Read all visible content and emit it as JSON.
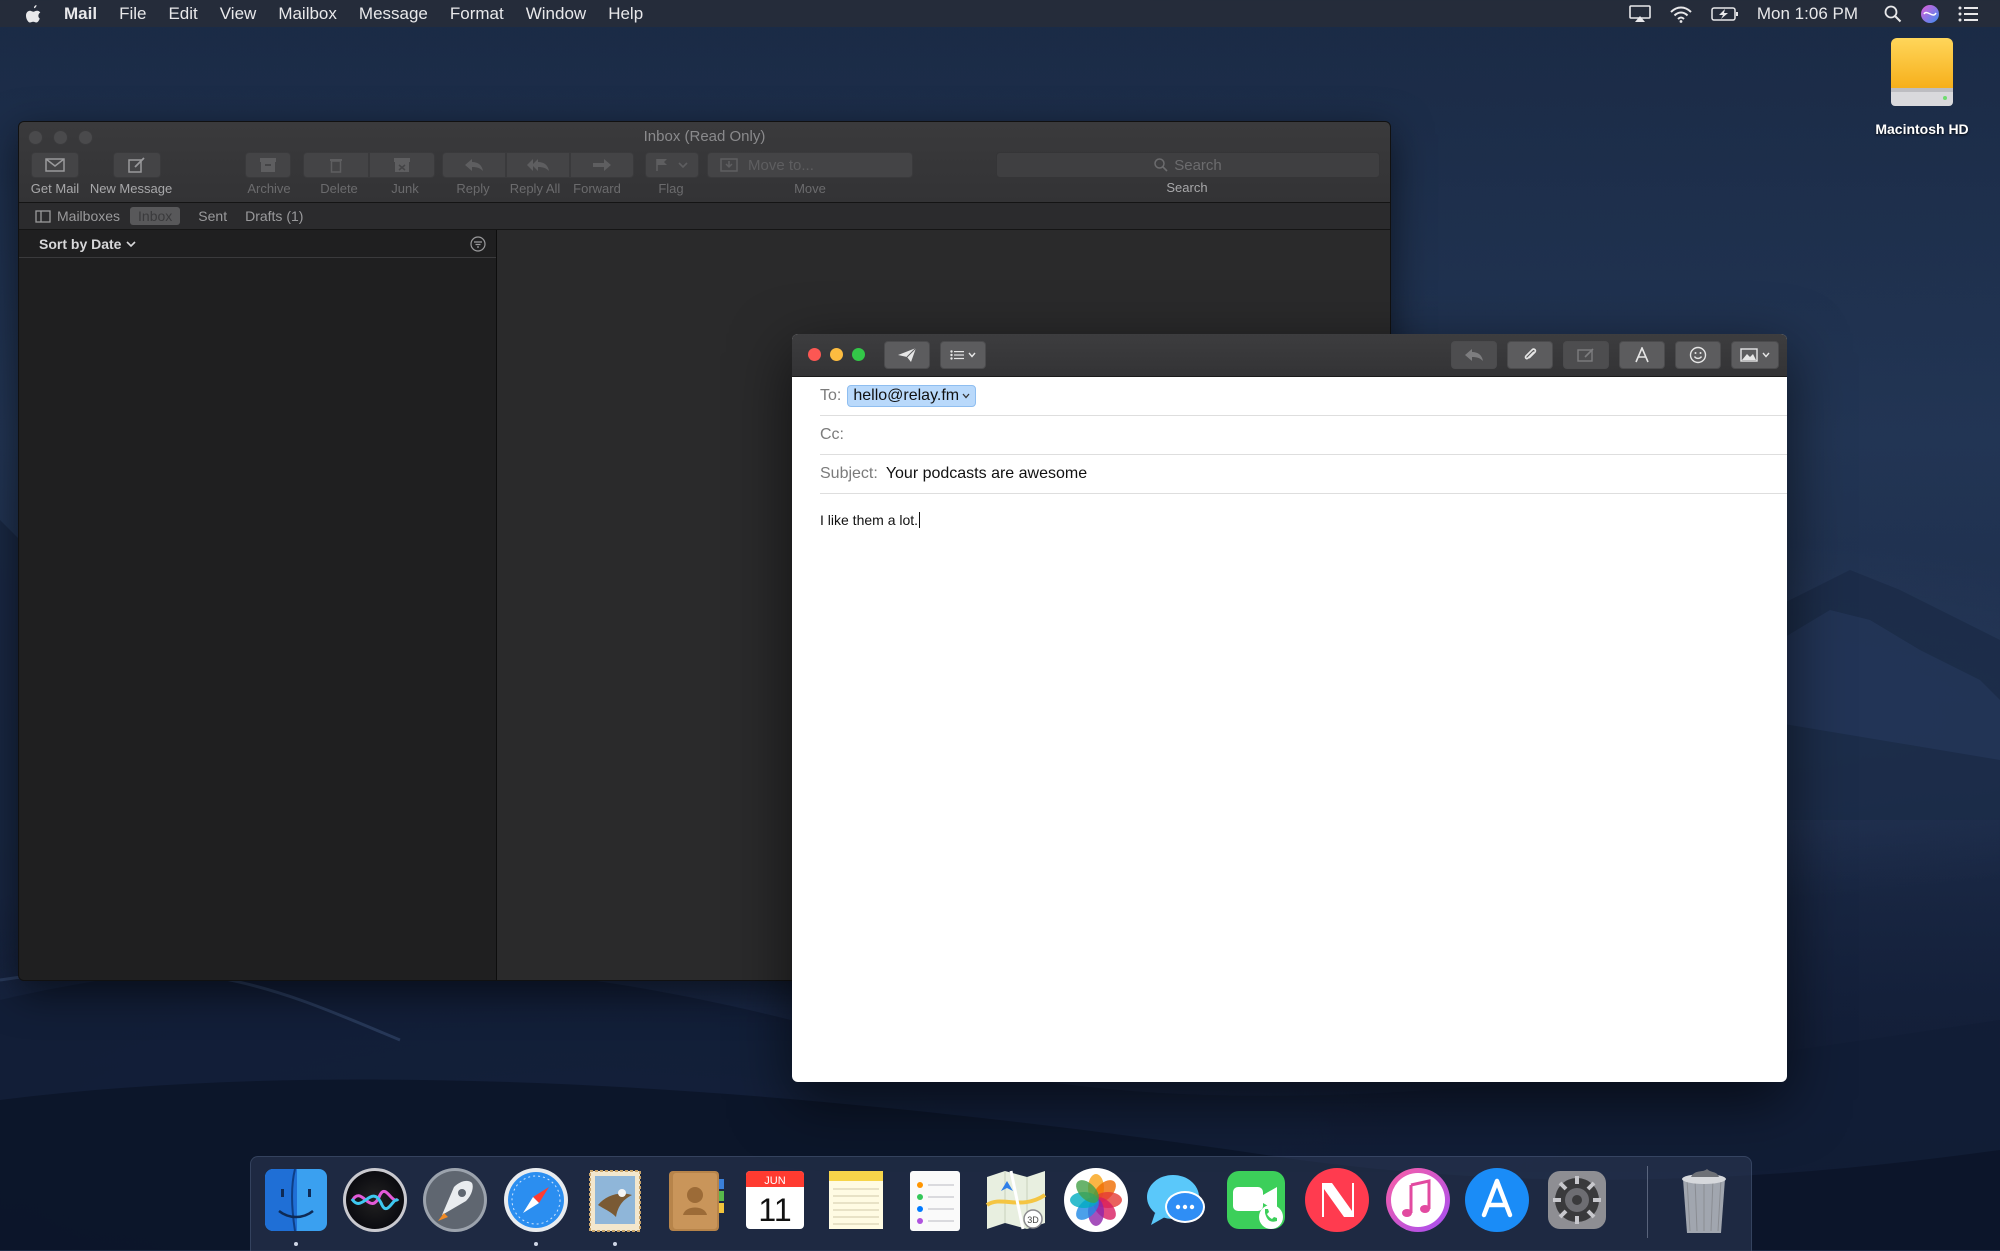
{
  "menubar": {
    "app_name": "Mail",
    "menus": [
      "File",
      "Edit",
      "View",
      "Mailbox",
      "Message",
      "Format",
      "Window",
      "Help"
    ],
    "clock": "Mon 1:06 PM",
    "status_icons": [
      "airplay-icon",
      "wifi-icon",
      "battery-icon",
      "spotlight-icon",
      "siri-icon",
      "notification-center-icon"
    ]
  },
  "desktop": {
    "drive_label": "Macintosh HD"
  },
  "viewer": {
    "title": "Inbox (Read Only)",
    "toolbar": {
      "get_mail": "Get Mail",
      "new_message": "New Message",
      "archive": "Archive",
      "delete": "Delete",
      "junk": "Junk",
      "reply": "Reply",
      "reply_all": "Reply All",
      "forward": "Forward",
      "flag": "Flag",
      "move_to": "Move to...",
      "move": "Move",
      "search_placeholder": "Search",
      "search_label": "Search"
    },
    "favorites": {
      "mailboxes": "Mailboxes",
      "inbox": "Inbox",
      "sent": "Sent",
      "drafts": "Drafts (1)"
    },
    "sort_label": "Sort by Date"
  },
  "compose": {
    "to_label": "To:",
    "to_value": "hello@relay.fm",
    "cc_label": "Cc:",
    "subject_label": "Subject:",
    "subject_value": "Your podcasts are awesome",
    "body": "I like them a lot."
  },
  "dock": {
    "apps": [
      "finder-icon",
      "siri-icon",
      "launchpad-icon",
      "safari-icon",
      "mail-icon",
      "contacts-icon",
      "calendar-icon",
      "notes-icon",
      "reminders-icon",
      "maps-icon",
      "photos-icon",
      "messages-icon",
      "facetime-icon",
      "news-icon",
      "itunes-icon",
      "app-store-icon",
      "system-preferences-icon",
      "trash-icon"
    ],
    "calendar_month": "JUN",
    "calendar_day": "11",
    "maps_badge": "3D"
  },
  "colors": {
    "close": "#fc5753",
    "minimize": "#fdbc40",
    "zoom": "#33c748",
    "token_bg": "#b9d9fb"
  }
}
